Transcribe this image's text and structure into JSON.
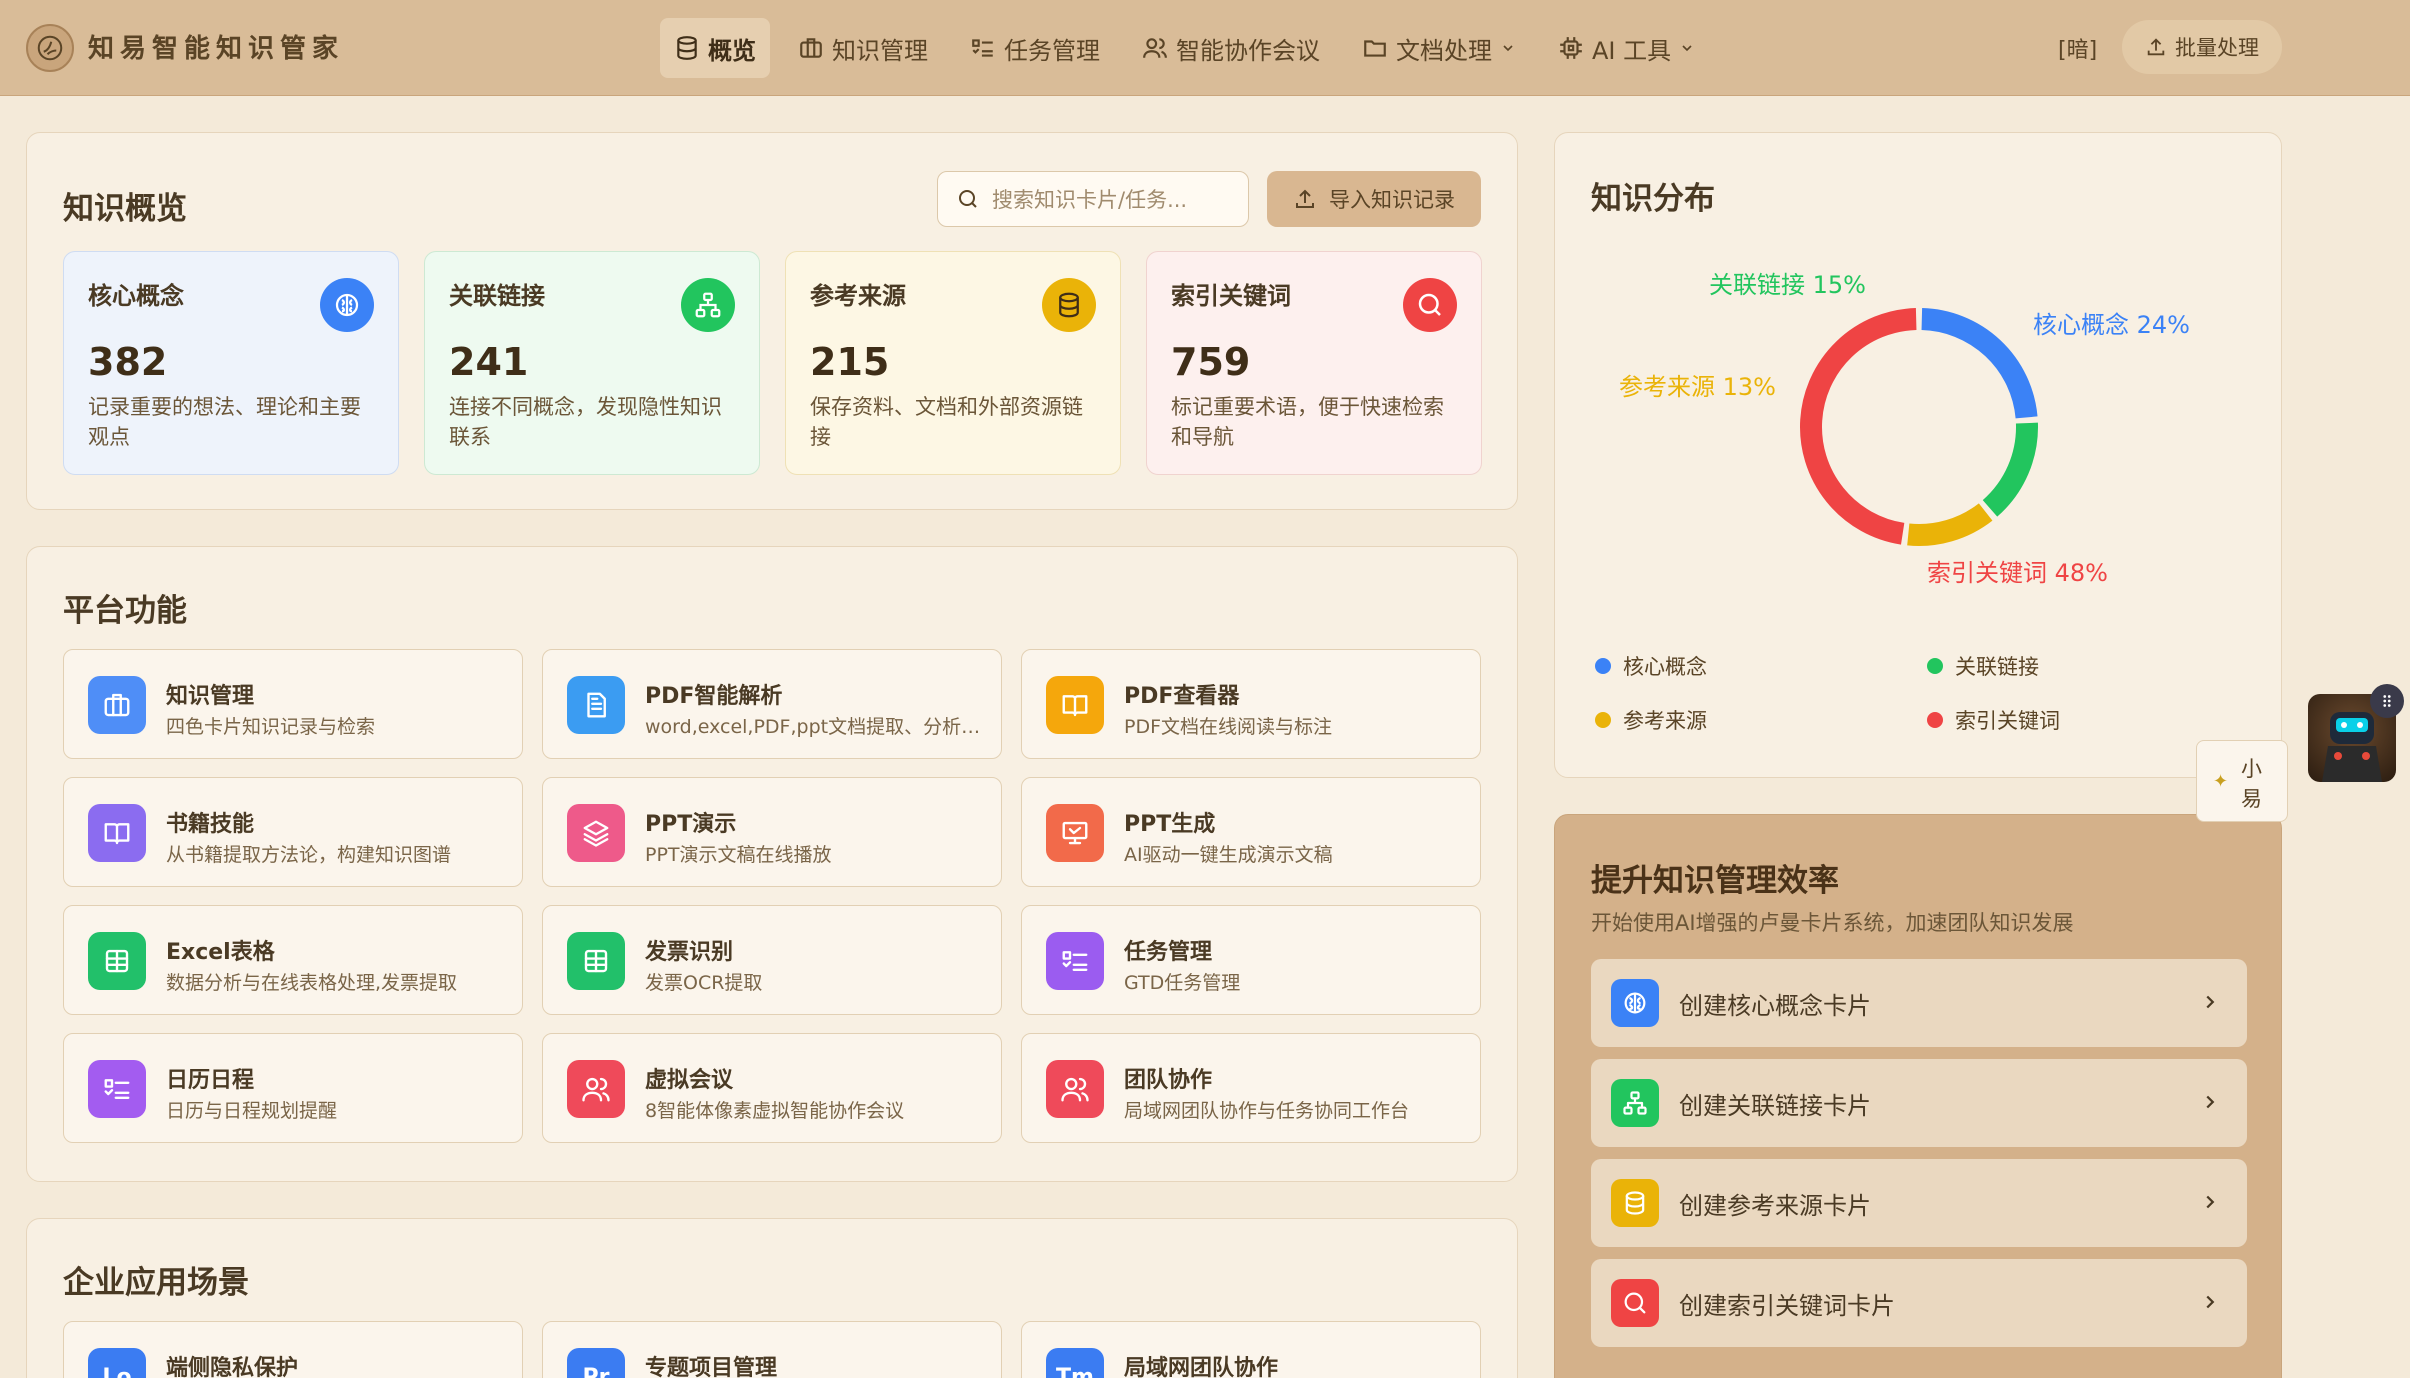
{
  "header": {
    "logo_text": "知易智能知识管家",
    "nav": [
      {
        "label": "概览",
        "icon": "database-icon",
        "active": true
      },
      {
        "label": "知识管理",
        "icon": "briefcase-icon"
      },
      {
        "label": "任务管理",
        "icon": "checklist-icon"
      },
      {
        "label": "智能协作会议",
        "icon": "users-icon"
      },
      {
        "label": "文档处理",
        "icon": "folder-icon",
        "dropdown": true
      },
      {
        "label": "AI 工具",
        "icon": "cpu-icon",
        "dropdown": true
      }
    ],
    "dark_toggle": "[暗]",
    "batch_label": "批量处理"
  },
  "overview": {
    "title": "知识概览",
    "search_placeholder": "搜索知识卡片/任务...",
    "import_label": "导入知识记录",
    "stats": [
      {
        "title": "核心概念",
        "value": "382",
        "desc": "记录重要的想法、理论和主要观点",
        "color": "#3b82f6",
        "bg": "#eef3fb",
        "border": "#cfdcf2",
        "icon": "brain-icon"
      },
      {
        "title": "关联链接",
        "value": "241",
        "desc": "连接不同概念，发现隐性知识联系",
        "color": "#22c55e",
        "bg": "#eefaf0",
        "border": "#cde9d3",
        "icon": "network-icon"
      },
      {
        "title": "参考来源",
        "value": "215",
        "desc": "保存资料、文档和外部资源链接",
        "color": "#eab308",
        "bg": "#fdf7e4",
        "border": "#efe1b5",
        "icon": "database-icon"
      },
      {
        "title": "索引关键词",
        "value": "759",
        "desc": "标记重要术语，便于快速检索和导航",
        "color": "#ef4444",
        "bg": "#fdf0ee",
        "border": "#f0d3cf",
        "icon": "search-icon"
      }
    ]
  },
  "platform": {
    "title": "平台功能",
    "features": [
      {
        "title": "知识管理",
        "desc": "四色卡片知识记录与检索",
        "color": "#4f8ef7",
        "icon": "briefcase-icon"
      },
      {
        "title": "PDF智能解析",
        "desc": "word,excel,PDF,ppt文档提取、分析、总结",
        "color": "#3b9cf2",
        "icon": "document-icon"
      },
      {
        "title": "PDF查看器",
        "desc": "PDF文档在线阅读与标注",
        "color": "#f5a70c",
        "icon": "book-open-icon"
      },
      {
        "title": "书籍技能",
        "desc": "从书籍提取方法论，构建知识图谱",
        "color": "#8b6cf0",
        "icon": "book-icon"
      },
      {
        "title": "PPT演示",
        "desc": "PPT演示文稿在线播放",
        "color": "#ee5a8a",
        "icon": "layers-icon"
      },
      {
        "title": "PPT生成",
        "desc": "AI驱动一键生成演示文稿",
        "color": "#f26a4a",
        "icon": "presentation-icon"
      },
      {
        "title": "Excel表格",
        "desc": "数据分析与在线表格处理,发票提取",
        "color": "#22c06a",
        "icon": "table-icon"
      },
      {
        "title": "发票识别",
        "desc": "发票OCR提取",
        "color": "#22c06a",
        "icon": "table-icon"
      },
      {
        "title": "任务管理",
        "desc": "GTD任务管理",
        "color": "#9b5cf0",
        "icon": "checklist-icon"
      },
      {
        "title": "日历日程",
        "desc": "日历与日程规划提醒",
        "color": "#a35cf0",
        "icon": "checklist-icon"
      },
      {
        "title": "虚拟会议",
        "desc": "8智能体像素虚拟智能协作会议",
        "color": "#ef4a5a",
        "icon": "users-icon"
      },
      {
        "title": "团队协作",
        "desc": "局域网团队协作与任务协同工作台",
        "color": "#ef4a5a",
        "icon": "users-icon"
      }
    ]
  },
  "enterprise": {
    "title": "企业应用场景",
    "items": [
      {
        "title": "端侧隐私保护",
        "badge": "Lo",
        "color": "#3b7cf2"
      },
      {
        "title": "专题项目管理",
        "badge": "Pr",
        "color": "#3b7cf2"
      },
      {
        "title": "局域网团队协作",
        "badge": "Tm",
        "color": "#3b7cf2"
      }
    ]
  },
  "distribution": {
    "title": "知识分布",
    "chart_data": {
      "type": "pie",
      "categories": [
        "核心概念",
        "关联链接",
        "参考来源",
        "索引关键词"
      ],
      "values": [
        24,
        15,
        13,
        48
      ],
      "labels": [
        "核心概念 24%",
        "关联链接 15%",
        "参考来源 13%",
        "索引关键词 48%"
      ],
      "colors": [
        "#3b82f6",
        "#22c55e",
        "#eab308",
        "#ef4444"
      ],
      "legend": "bottom"
    }
  },
  "efficiency": {
    "title": "提升知识管理效率",
    "subtitle": "开始使用AI增强的卢曼卡片系统，加速团队知识发展",
    "buttons": [
      {
        "label": "创建核心概念卡片",
        "color": "#3b82f6",
        "icon": "brain-icon"
      },
      {
        "label": "创建关联链接卡片",
        "color": "#22c55e",
        "icon": "network-icon"
      },
      {
        "label": "创建参考来源卡片",
        "color": "#eab308",
        "icon": "database-icon"
      },
      {
        "label": "创建索引关键词卡片",
        "color": "#ef4444",
        "icon": "search-icon"
      }
    ]
  },
  "assistant": {
    "line1": "小",
    "line2": "易"
  }
}
